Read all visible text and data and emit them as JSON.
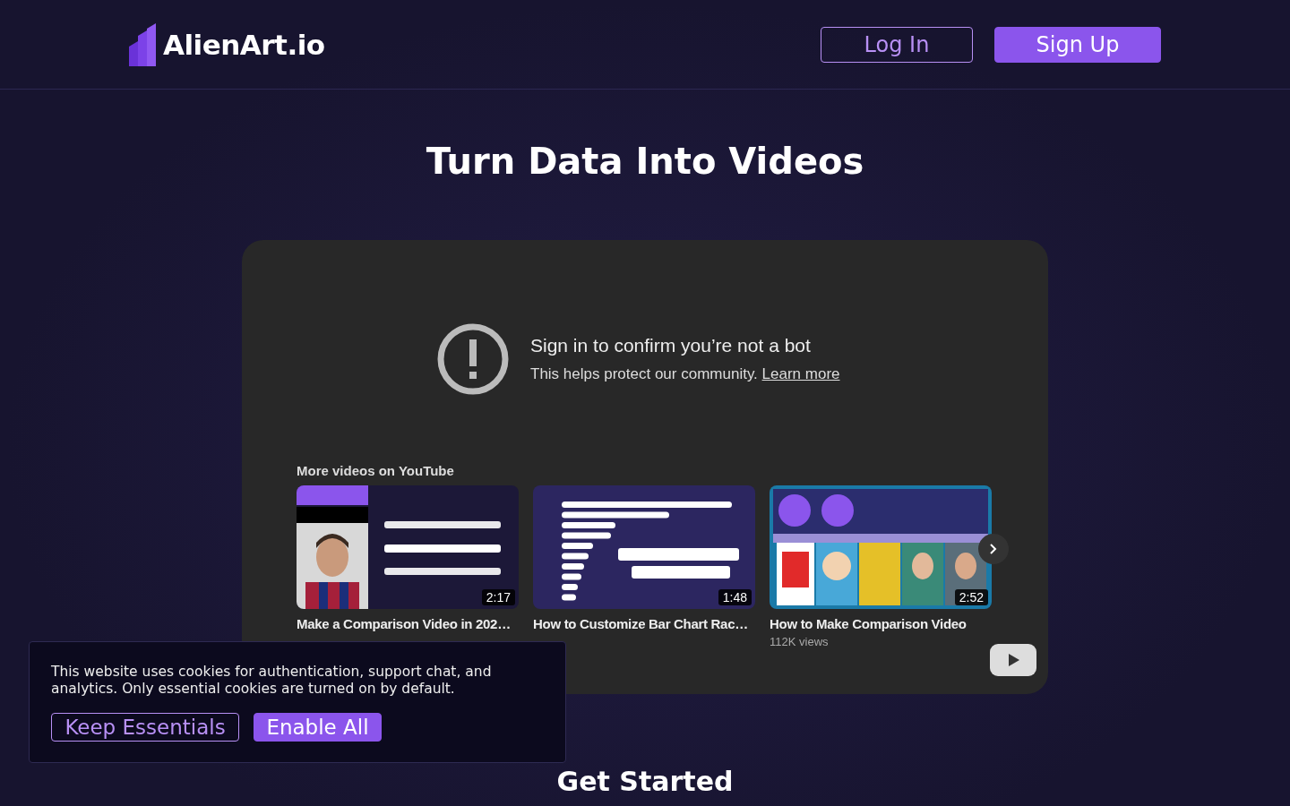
{
  "header": {
    "logo": "AlienArt.io",
    "buttons": [
      {
        "label": "Log In",
        "kind": "outline"
      },
      {
        "label": "Sign Up",
        "kind": "filled"
      }
    ]
  },
  "hero": {
    "title": "Turn Data Into Videos"
  },
  "player": {
    "notice": {
      "title": "Sign in to confirm you’re not a bot",
      "text": "This helps protect our community. ",
      "link": "Learn more"
    },
    "more_title": "More videos on YouTube",
    "videos": [
      {
        "title": "Make a Comparison Video in 202…",
        "duration": "2:17",
        "kind": "picture"
      },
      {
        "title": "How to Customize Bar Chart Rac…",
        "duration": "1:48",
        "kind": "picture"
      },
      {
        "title": "How to Make Comparison Video",
        "duration": "2:52",
        "views": "112K views",
        "kind": "picture"
      }
    ]
  },
  "cookie_banner": {
    "text": "This website uses cookies for authentication, support chat, and analytics. Only essential cookies are turned on by default.",
    "buttons": [
      {
        "label": "Keep Essentials",
        "kind": "outline"
      },
      {
        "label": "Enable All",
        "kind": "filled"
      }
    ]
  },
  "next_section": {
    "title": "Get Started"
  }
}
